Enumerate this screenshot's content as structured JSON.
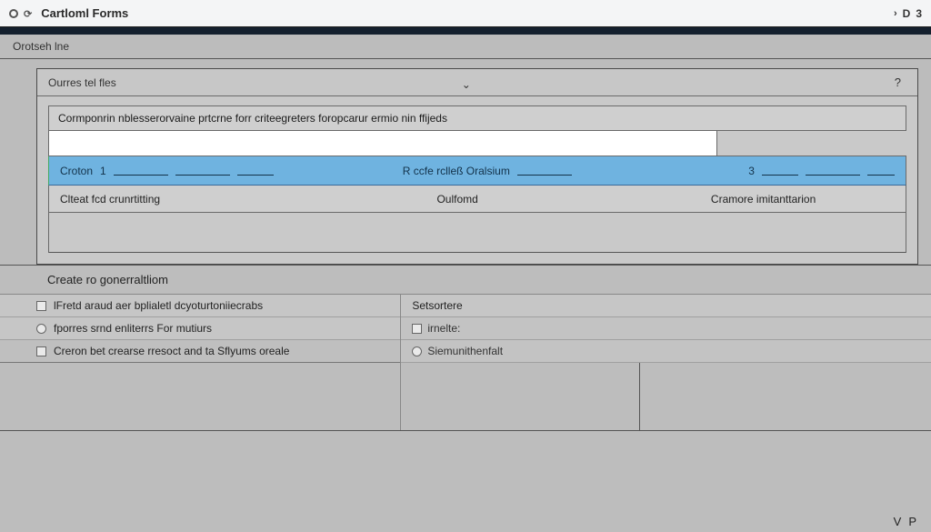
{
  "titlebar": {
    "app_icon": "circle-icon",
    "refresh_icon": "refresh-icon",
    "title": "Cartloml Forms",
    "right_chevron": "›",
    "right_icon": "D",
    "right_badge": "3"
  },
  "subheader": {
    "label": "Orotseh lne"
  },
  "panel": {
    "header": "Ourres tel fles",
    "help": "?",
    "description": "Cormponrin nblesserorvaine prtcrne forr criteegreters foropcarur ermio nin ffijeds",
    "blue": {
      "col1_label": "Croton",
      "col1_num": "1",
      "col2_label": "R ccfe rclleß Oralsium",
      "col3_num": "3"
    },
    "row": {
      "c1": "Clteat fcd crunrtitting",
      "c2": "Oulfomd",
      "c3": "Cramore imitanttarion"
    }
  },
  "section2": {
    "title": "Create ro gonerraltliom",
    "left": [
      "lFretd araud aer bplialetl dcyoturtoniiecrabs",
      "fporres srnd enliterrs For mutiurs",
      "Creron bet crearse rresoct and ta Sflyums oreale"
    ],
    "right": {
      "head": "Setsortere",
      "item1": "irnelte:",
      "item2": "Siemunithenfalt"
    }
  },
  "footer": {
    "v": "V",
    "p": "P"
  }
}
